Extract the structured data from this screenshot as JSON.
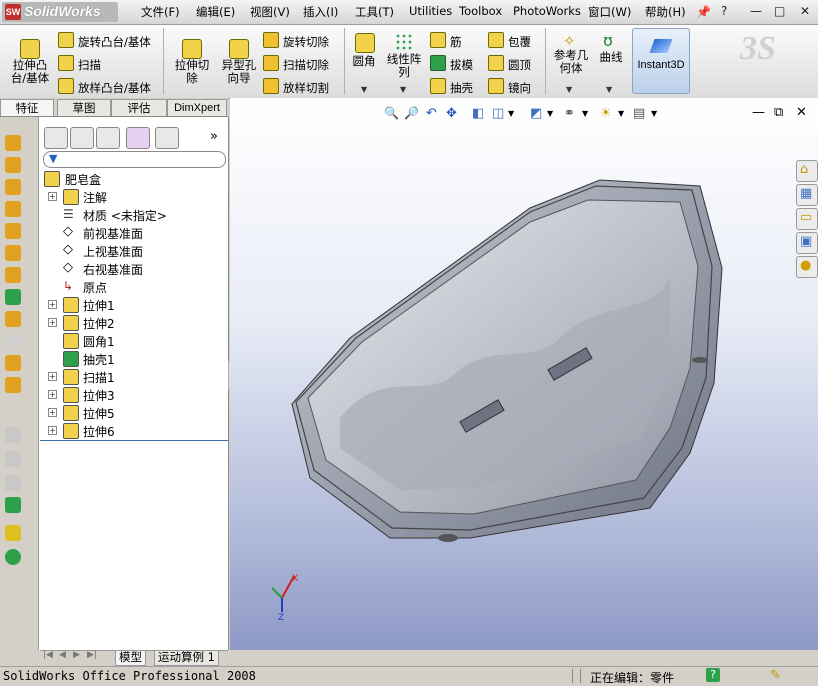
{
  "app": {
    "name": "SolidWorks",
    "logo_letters": "SW"
  },
  "menu": [
    "文件(F)",
    "编辑(E)",
    "视图(V)",
    "插入(I)",
    "工具(T)",
    "Utilities",
    "Toolbox",
    "PhotoWorks",
    "窗口(W)",
    "帮助(H)"
  ],
  "window_buttons": [
    "?",
    "—",
    "□",
    "✕"
  ],
  "command_manager": {
    "extrude_boss": "拉伸凸台/基体",
    "revolve_boss": "旋转凸台/基体",
    "sweep": "扫描",
    "loft_boss": "放样凸台/基体",
    "extrude_cut": "拉伸切除",
    "hole_wizard": "异型孔向导",
    "revolve_cut": "旋转切除",
    "sweep_cut": "扫描切除",
    "loft_cut": "放样切割",
    "fillet": "圆角",
    "linear_pattern": "线性阵列",
    "rib": "筋",
    "draft": "拔模",
    "shell": "抽壳",
    "wrap": "包覆",
    "dome": "圆顶",
    "mirror": "镜向",
    "ref_geometry": "参考几何体",
    "curves": "曲线",
    "instant3d": "Instant3D"
  },
  "feature_tabs": [
    "特征",
    "草图",
    "评估",
    "DimXpert"
  ],
  "feature_tree": {
    "root": "肥皂盒",
    "items": [
      {
        "label": "注解",
        "icon": "annotation-icon",
        "expandable": true
      },
      {
        "label": "材质 <未指定>",
        "icon": "material-icon",
        "expandable": false
      },
      {
        "label": "前视基准面",
        "icon": "plane-icon",
        "expandable": false
      },
      {
        "label": "上视基准面",
        "icon": "plane-icon",
        "expandable": false
      },
      {
        "label": "右视基准面",
        "icon": "plane-icon",
        "expandable": false
      },
      {
        "label": "原点",
        "icon": "origin-icon",
        "expandable": false
      },
      {
        "label": "拉伸1",
        "icon": "extrude-icon",
        "expandable": true
      },
      {
        "label": "拉伸2",
        "icon": "extrude-icon",
        "expandable": true
      },
      {
        "label": "圆角1",
        "icon": "fillet-icon",
        "expandable": false
      },
      {
        "label": "抽壳1",
        "icon": "shell-icon",
        "expandable": false
      },
      {
        "label": "扫描1",
        "icon": "sweep-icon",
        "expandable": true
      },
      {
        "label": "拉伸3",
        "icon": "extrude-icon",
        "expandable": true
      },
      {
        "label": "拉伸5",
        "icon": "extrude-icon",
        "expandable": true
      },
      {
        "label": "拉伸6",
        "icon": "extrude-icon",
        "expandable": true
      }
    ]
  },
  "bottom_tabs": [
    "模型",
    "运动算例 1"
  ],
  "status": {
    "product": "SolidWorks Office Professional 2008",
    "editing": "正在编辑：零件",
    "help": "?"
  },
  "colors": {
    "viewport_top": "#ffffff",
    "viewport_bottom": "#8d99c6",
    "model_gray": "#9aa0ad",
    "selection_blue": "#3b6ea5"
  }
}
